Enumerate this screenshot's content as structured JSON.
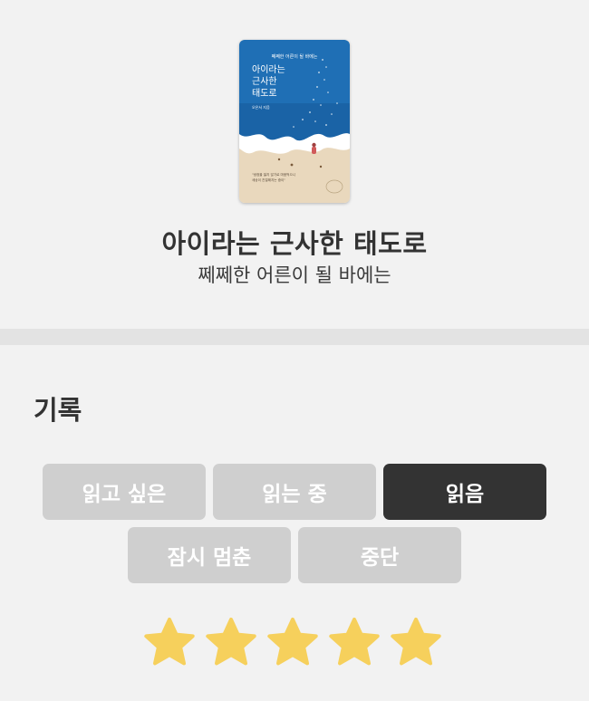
{
  "book": {
    "cover": {
      "top_line": "쩨쩨한 어른이 될 바에는",
      "title_line1": "아이라는",
      "title_line2": "근사한",
      "title_line3": "태도로",
      "author": "오은서 지음",
      "quote_line1": "\"냉정을 잃지 않기로 마음먹으니",
      "quote_line2": "세상이 친절해지는 중이\"",
      "sky_color": "#1f6fb5",
      "sand_color": "#e9d8bd"
    },
    "title": "아이라는 근사한 태도로",
    "subtitle": "쩨쩨한 어른이 될 바에는"
  },
  "record": {
    "section_title": "기록",
    "statuses": [
      {
        "label": "읽고 싶은",
        "selected": false
      },
      {
        "label": "읽는 중",
        "selected": false
      },
      {
        "label": "읽음",
        "selected": true
      },
      {
        "label": "잠시 멈춘",
        "selected": false
      },
      {
        "label": "중단",
        "selected": false
      }
    ],
    "rating": 5,
    "rating_max": 5,
    "star_icon": "star-icon"
  },
  "colors": {
    "background": "#f2f2f2",
    "divider": "#e3e3e3",
    "button_default": "#cfcfcf",
    "button_selected": "#333333",
    "star_fill": "#f6d05c"
  }
}
